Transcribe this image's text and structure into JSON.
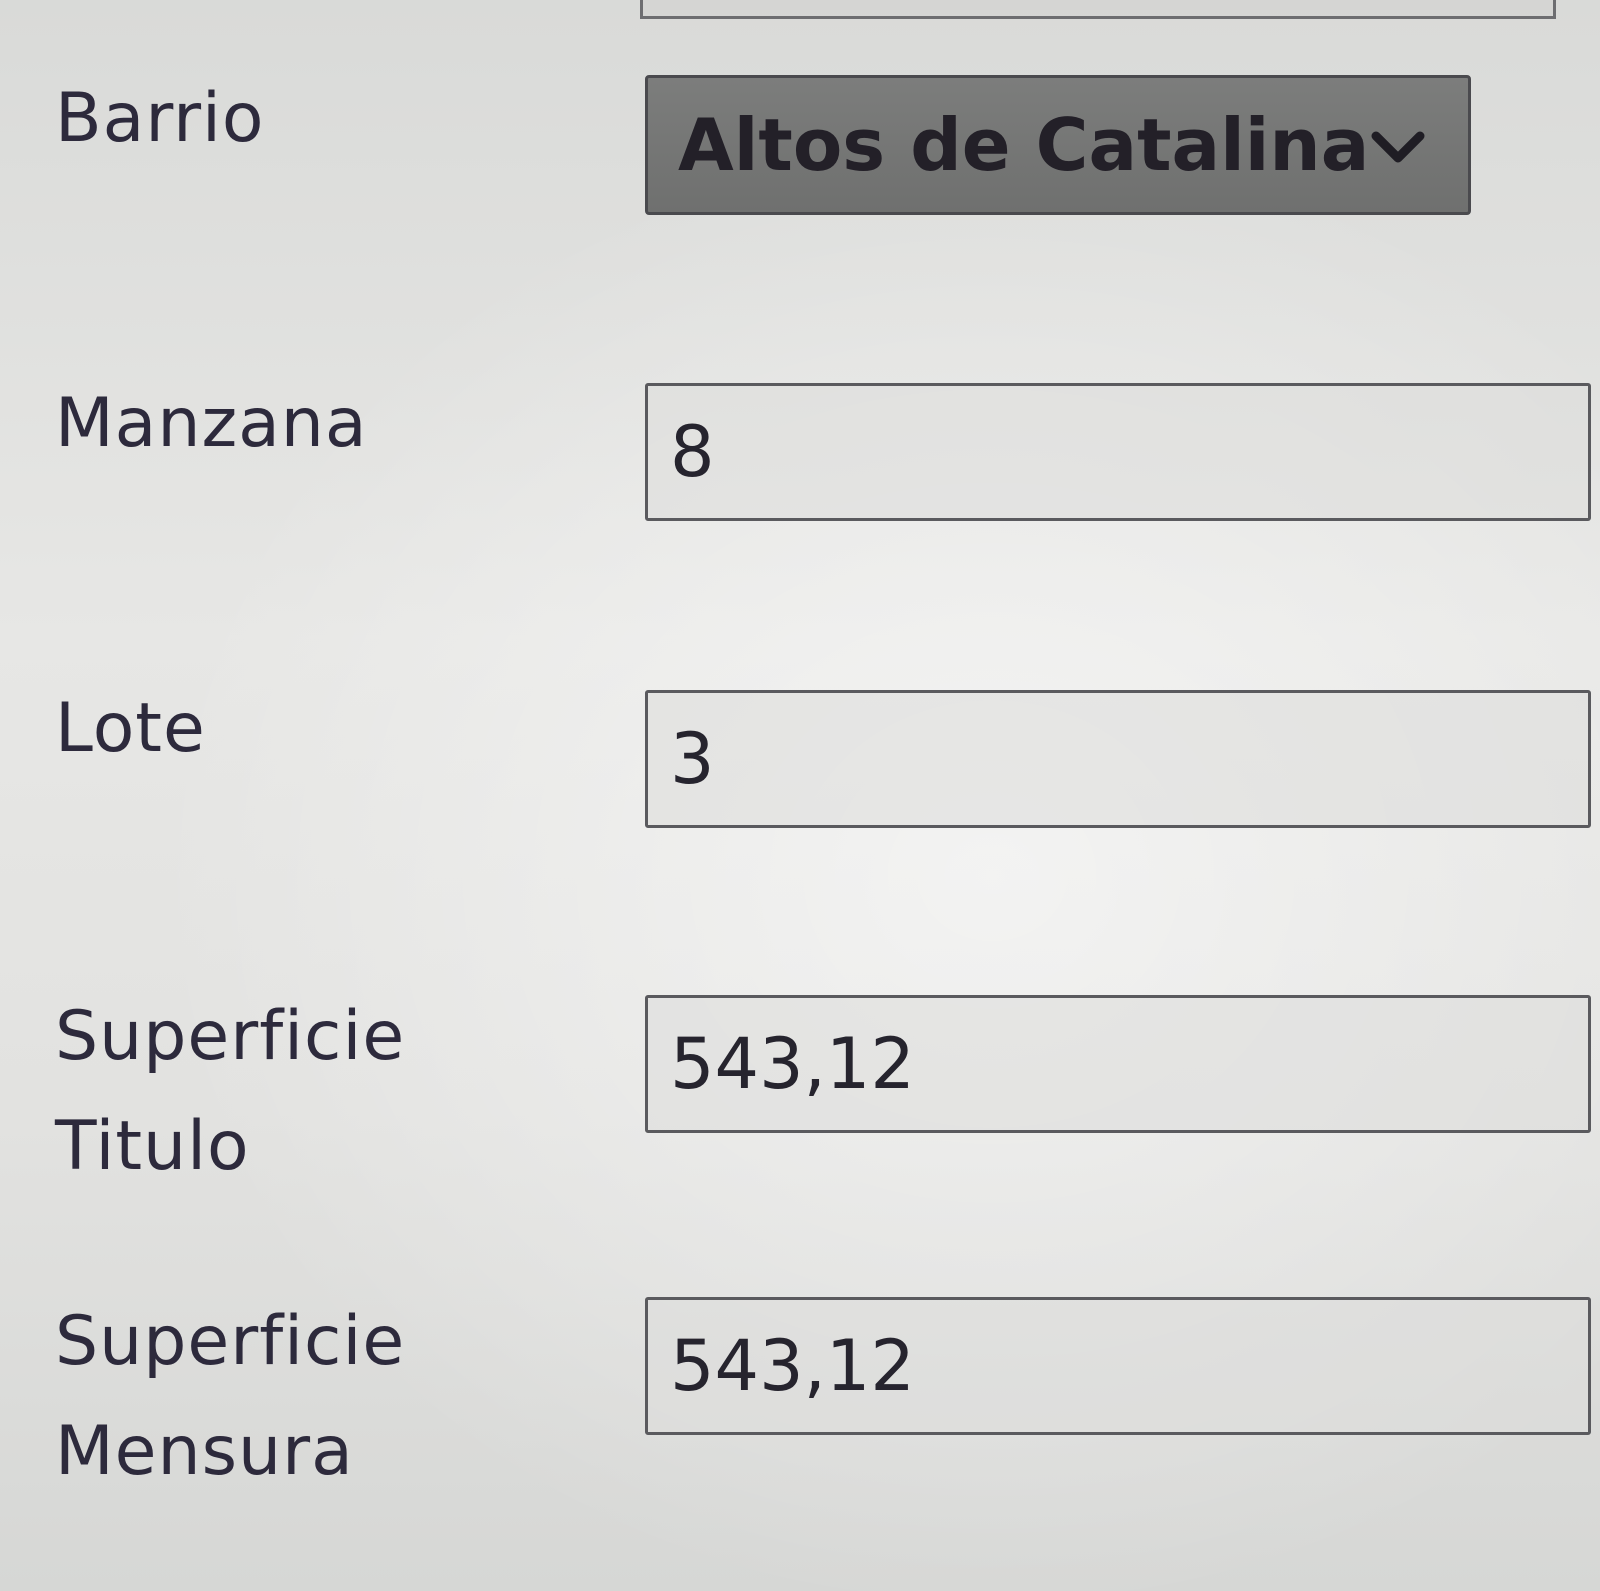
{
  "form": {
    "barrio": {
      "label": "Barrio",
      "selected": "Altos de Catalina",
      "icon": "chevron-down-icon"
    },
    "manzana": {
      "label": "Manzana",
      "value": "8"
    },
    "lote": {
      "label": "Lote",
      "value": "3"
    },
    "superficie_titulo": {
      "label_line1": "Superficie",
      "label_line2": "Titulo",
      "value": "543,12"
    },
    "superficie_mensura": {
      "label_line1": "Superficie",
      "label_line2": "Mensura",
      "value": "543,12"
    }
  }
}
